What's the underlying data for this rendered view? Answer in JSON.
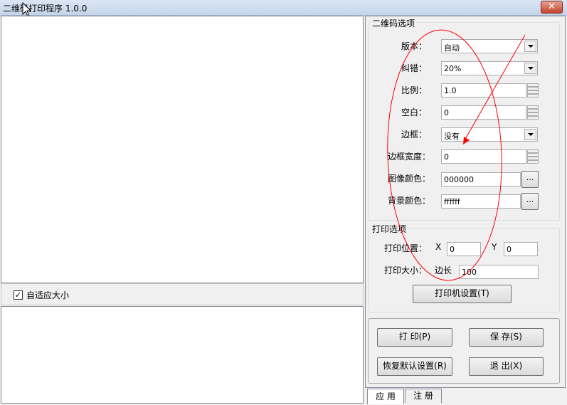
{
  "window": {
    "title": "二维码打印程序 1.0.0",
    "close_icon": "✕"
  },
  "left": {
    "auto_fit_label": "自适应大小",
    "auto_fit_checked": true,
    "check_glyph": "✓"
  },
  "qr_options": {
    "title": "二维码选项",
    "version_label": "版本：",
    "version_value": "自动",
    "ecc_label": "纠错：",
    "ecc_value": "20%",
    "scale_label": "比例：",
    "scale_value": "1.0",
    "margin_label": "空白：",
    "margin_value": "0",
    "border_label": "边框：",
    "border_value": "没有",
    "border_width_label": "边框宽度：",
    "border_width_value": "0",
    "fg_color_label": "图像颜色：",
    "fg_color_value": "000000",
    "bg_color_label": "背景颜色：",
    "bg_color_value": "ffffff",
    "ellipsis": "..."
  },
  "print_options": {
    "title": "打印选项",
    "position_label": "打印位置：",
    "x_label": "X",
    "x_value": "0",
    "y_label": "Y",
    "y_value": "0",
    "size_label": "打印大小：",
    "side_label": "边长",
    "side_value": "100",
    "printer_setup_button": "打印机设置(T)"
  },
  "actions": {
    "print_button": "打  印(P)",
    "save_button": "保  存(S)",
    "restore_button": "恢复默认设置(R)",
    "exit_button": "退  出(X)"
  },
  "tabs": [
    {
      "label": "应 用"
    },
    {
      "label": "注 册"
    }
  ],
  "colors": {
    "annotation": "#ff0000"
  }
}
